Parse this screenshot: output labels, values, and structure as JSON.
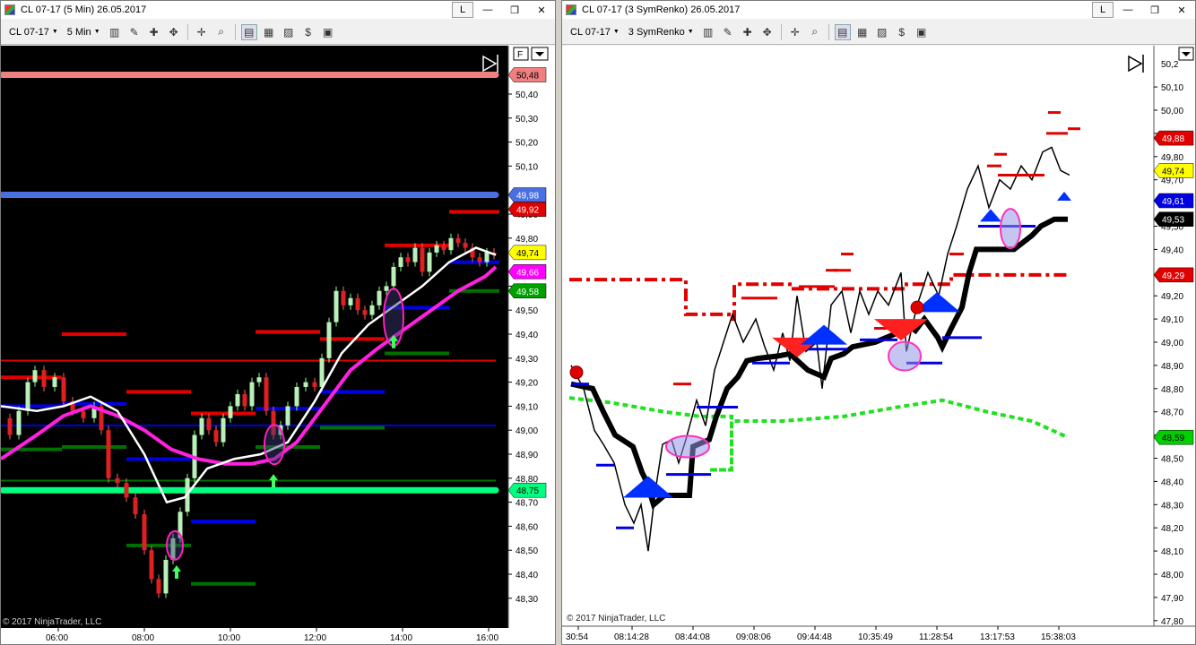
{
  "left_window": {
    "title": "CL 07-17 (5 Min)  26.05.2017",
    "instrument": "CL 07-17",
    "period": "5 Min",
    "flag_label": "F",
    "watermark": "© 2017 NinjaTrader, LLC",
    "price_ticks": [
      "50,40",
      "50,30",
      "50,20",
      "50,10",
      "49,90",
      "49,80",
      "49,60",
      "49,50",
      "49,40",
      "49,30",
      "49,20",
      "49,10",
      "49,00",
      "48,90",
      "48,80",
      "48,70",
      "48,60",
      "48,50",
      "48,40",
      "48,30"
    ],
    "time_ticks": [
      "06:00",
      "08:00",
      "10:00",
      "12:00",
      "14:00",
      "16:00"
    ],
    "price_flags": [
      {
        "text": "50,48",
        "bg": "#f08080",
        "fg": "#000"
      },
      {
        "text": "49,98",
        "bg": "#4a6fe0",
        "fg": "#fff"
      },
      {
        "text": "49,92",
        "bg": "#e00000",
        "fg": "#fff"
      },
      {
        "text": "49,74",
        "bg": "#ffff00",
        "fg": "#000"
      },
      {
        "text": "49,66",
        "bg": "#ff00ff",
        "fg": "#fff"
      },
      {
        "text": "49,58",
        "bg": "#00a000",
        "fg": "#fff"
      },
      {
        "text": "48,75",
        "bg": "#00ff80",
        "fg": "#000"
      }
    ]
  },
  "right_window": {
    "title": "CL 07-17 (3 SymRenko)  26.05.2017",
    "instrument": "CL 07-17",
    "period": "3 SymRenko",
    "watermark": "© 2017 NinjaTrader, LLC",
    "price_ticks": [
      "50,10",
      "50,00",
      "49,90",
      "49,80",
      "49,70",
      "49,50",
      "49,40",
      "49,20",
      "49,10",
      "49,00",
      "48,90",
      "48,80",
      "48,70",
      "48,60",
      "48,50",
      "48,40",
      "48,30",
      "48,20",
      "48,10",
      "48,00",
      "47,90",
      "47,80"
    ],
    "top_tick": "50,2",
    "time_ticks": [
      "30:54",
      "08:14:28",
      "08:44:08",
      "09:08:06",
      "09:44:48",
      "10:35:49",
      "11:28:54",
      "13:17:53",
      "15:38:03"
    ],
    "price_flags": [
      {
        "text": "49,88",
        "bg": "#e00000",
        "fg": "#fff"
      },
      {
        "text": "49,74",
        "bg": "#ffff00",
        "fg": "#000"
      },
      {
        "text": "49,61",
        "bg": "#0000e0",
        "fg": "#fff"
      },
      {
        "text": "49,53",
        "bg": "#000000",
        "fg": "#fff"
      },
      {
        "text": "49,29",
        "bg": "#e00000",
        "fg": "#fff"
      },
      {
        "text": "48,59",
        "bg": "#00d000",
        "fg": "#000"
      }
    ]
  },
  "window_buttons": {
    "minimize": "—",
    "restore": "❐",
    "close": "✕",
    "layout": "L"
  },
  "toolbar_icons": [
    "bar-type-icon",
    "pencil-icon",
    "draw-tools-icon",
    "crosshair-icon",
    "zoom-icon",
    "properties-icon",
    "indicators-icon",
    "strategies-icon",
    "data-box-icon"
  ]
}
